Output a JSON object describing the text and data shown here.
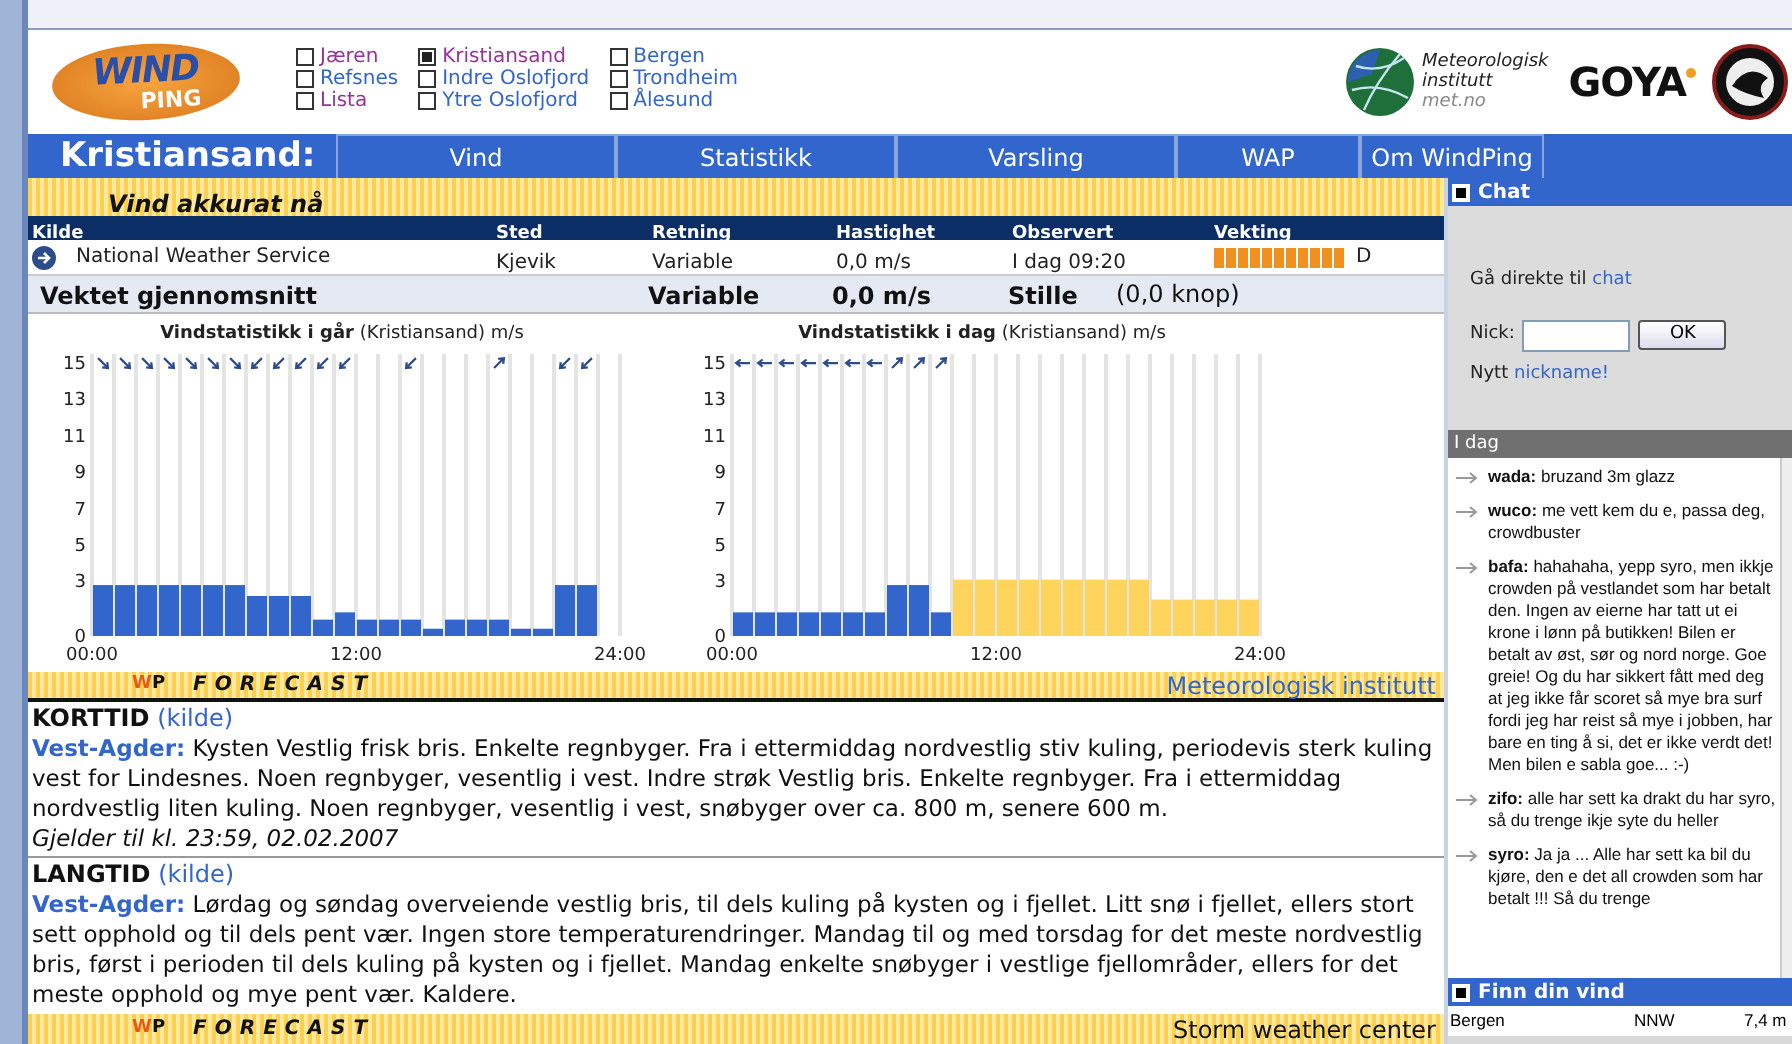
{
  "logo": {
    "word_1": "WIND",
    "word_2": "PING"
  },
  "locations": [
    {
      "label": "Jæren",
      "checked": false,
      "color": "#993399"
    },
    {
      "label": "Refsnes",
      "checked": false,
      "color": "#3366cc"
    },
    {
      "label": "Lista",
      "checked": false,
      "color": "#993399"
    },
    {
      "label": "Kristiansand",
      "checked": true,
      "color": "#993399"
    },
    {
      "label": "Indre Oslofjord",
      "checked": false,
      "color": "#3366cc"
    },
    {
      "label": "Ytre Oslofjord",
      "checked": false,
      "color": "#3366cc"
    },
    {
      "label": "Bergen",
      "checked": false,
      "color": "#3366cc"
    },
    {
      "label": "Trondheim",
      "checked": false,
      "color": "#3366cc"
    },
    {
      "label": "Ålesund",
      "checked": false,
      "color": "#3366cc"
    }
  ],
  "partners": {
    "met_lines": [
      "Meteorologisk",
      "institutt",
      "met.no"
    ],
    "goya": "GOYA"
  },
  "nav": {
    "title": "Kristiansand:",
    "tabs": [
      "Vind",
      "Statistikk",
      "Varsling",
      "WAP",
      "Om WindPing"
    ]
  },
  "current": {
    "title": "Vind akkurat nå",
    "columns": [
      "Kilde",
      "Sted",
      "Retning",
      "Hastighet",
      "Observert",
      "Vekting"
    ],
    "rows": [
      {
        "cells": [
          "National Weather Service",
          "Kjevik",
          "Variable",
          "0,0 m/s",
          "I dag 09:20"
        ],
        "weight": {
          "level": 1,
          "grade": "D"
        }
      }
    ],
    "average": {
      "label": "Vektet gjennomsnitt",
      "direction": "Variable",
      "speed": "0,0 m/s",
      "description": "Stille",
      "knots": "(0,0 knop)"
    }
  },
  "charts": [
    {
      "arrows": [
        {
          "kind": "se"
        },
        {
          "kind": "se"
        },
        {
          "kind": "se"
        },
        {
          "kind": "se"
        },
        {
          "kind": "se"
        },
        {
          "kind": "se"
        },
        {
          "kind": "se"
        },
        {
          "kind": "sw"
        },
        {
          "kind": "sw"
        },
        {
          "kind": "sw"
        },
        {
          "kind": "sw"
        },
        {
          "kind": "sw"
        },
        {
          "kind": "none"
        },
        {
          "kind": "none"
        },
        {
          "kind": "sw"
        },
        {
          "kind": "none"
        },
        {
          "kind": "none"
        },
        {
          "kind": "none"
        },
        {
          "kind": "ne"
        },
        {
          "kind": "none"
        },
        {
          "kind": "none"
        },
        {
          "kind": "sw"
        },
        {
          "kind": "sw"
        },
        {
          "kind": "none"
        }
      ],
      "chart_data": {
        "type": "bar",
        "title": "**Vindstatistikk i går** (Kristiansand) m/s",
        "x": [
          0.5,
          1.5,
          2.5,
          3.5,
          4.5,
          5.5,
          6.5,
          7.5,
          8.5,
          9.5,
          10.5,
          11.5,
          12.5,
          13.5,
          14.5,
          15.5,
          16.5,
          17.5,
          18.5,
          19.5,
          20.5,
          21.5,
          22.5
        ],
        "xlim": [
          0,
          24
        ],
        "xticks": [
          {
            "value": 0,
            "label": "00:00"
          },
          {
            "value": 12,
            "label": "12:00"
          },
          {
            "value": 24,
            "label": "24:00"
          }
        ],
        "ylim": [
          0,
          15.5
        ],
        "yticks": [
          0,
          3,
          5,
          7,
          9,
          11,
          13,
          15
        ],
        "series": [
          {
            "color": "#3366cc",
            "values": [
              2.8,
              2.8,
              2.8,
              2.8,
              2.8,
              2.8,
              2.8,
              2.2,
              2.2,
              2.2,
              0.9,
              1.3,
              0.9,
              0.9,
              0.9,
              0.4,
              0.9,
              0.9,
              0.9,
              0.4,
              0.4,
              2.8,
              2.8
            ]
          }
        ]
      }
    },
    {
      "arrows": [
        {
          "kind": "w"
        },
        {
          "kind": "w"
        },
        {
          "kind": "w"
        },
        {
          "kind": "w"
        },
        {
          "kind": "w"
        },
        {
          "kind": "w"
        },
        {
          "kind": "w"
        },
        {
          "kind": "ne"
        },
        {
          "kind": "ne"
        },
        {
          "kind": "ne"
        },
        {
          "kind": "none"
        },
        {
          "kind": "none"
        },
        {
          "kind": "none"
        },
        {
          "kind": "none"
        },
        {
          "kind": "none"
        },
        {
          "kind": "none"
        },
        {
          "kind": "none"
        },
        {
          "kind": "none"
        },
        {
          "kind": "none"
        },
        {
          "kind": "none"
        },
        {
          "kind": "none"
        },
        {
          "kind": "none"
        },
        {
          "kind": "none"
        },
        {
          "kind": "none"
        }
      ],
      "chart_data": {
        "type": "bar",
        "title": "**Vindstatistikk i dag** (Kristiansand) m/s",
        "x": [
          0.5,
          1.5,
          2.5,
          3.5,
          4.5,
          5.5,
          6.5,
          7.5,
          8.5,
          9.5,
          10.5,
          11.5,
          12.5,
          13.5,
          14.5,
          15.5,
          16.5,
          17.5,
          18.5,
          19.5,
          20.5,
          21.5,
          22.5,
          23.5
        ],
        "xlim": [
          0,
          24
        ],
        "xticks": [
          {
            "value": 0,
            "label": "00:00"
          },
          {
            "value": 12,
            "label": "12:00"
          },
          {
            "value": 24,
            "label": "24:00"
          }
        ],
        "ylim": [
          0,
          15.5
        ],
        "yticks": [
          0,
          3,
          5,
          7,
          9,
          11,
          13,
          15
        ],
        "series": [
          {
            "color": "#3366cc",
            "values": [
              1.3,
              1.3,
              1.3,
              1.3,
              1.3,
              1.3,
              1.3,
              2.8,
              2.8,
              1.3,
              null,
              null,
              null,
              null,
              null,
              null,
              null,
              null,
              null,
              null,
              null,
              null,
              null,
              null
            ]
          },
          {
            "color": "#ffd45c",
            "values": [
              null,
              null,
              null,
              null,
              null,
              null,
              null,
              null,
              null,
              null,
              3.1,
              3.1,
              3.1,
              3.1,
              3.1,
              3.1,
              3.1,
              3.1,
              3.1,
              2.0,
              2.0,
              2.0,
              2.0,
              2.0
            ]
          }
        ]
      }
    }
  ],
  "forecast_bars": [
    {
      "mark_1": "W",
      "mark_2": "P",
      "label": "FORECAST",
      "credit": "Meteorologisk institutt"
    },
    {
      "mark_1": "W",
      "mark_2": "P",
      "label": "FORECAST",
      "credit": "Storm weather center"
    }
  ],
  "forecasts": [
    {
      "title": "KORTTID",
      "link": "(kilde)",
      "region": "Vest-Agder:",
      "text": "Kysten Vestlig frisk bris. Enkelte regnbyger. Fra i ettermiddag nordvestlig stiv kuling, periodevis sterk kuling vest for Lindesnes. Noen regnbyger, vesentlig i vest. Indre strøk Vestlig bris. Enkelte regnbyger. Fra i ettermiddag nordvestlig liten kuling. Noen regnbyger, vesentlig i vest, snøbyger over ca. 800 m, senere 600 m.",
      "valid": "Gjelder til kl. 23:59, 02.02.2007"
    },
    {
      "title": "LANGTID",
      "link": "(kilde)",
      "region": "Vest-Agder:",
      "text": "Lørdag og søndag overveiende vestlig bris, til dels kuling på kysten og i fjellet. Litt snø i fjellet, ellers stort sett opphold og til dels pent vær. Ingen store temperaturendringer. Mandag til og med torsdag for det meste nordvestlig bris, først i perioden til dels kuling på kysten og i fjellet. Mandag enkelte snøbyger i vestlige fjellområder, ellers for det meste opphold og mye pent vær. Kaldere."
    }
  ],
  "chat": {
    "title": "Chat",
    "intro": "Gå direkte til",
    "intro_link": "chat",
    "nick_label": "Nick:",
    "ok": "OK",
    "new_text": "Nytt",
    "new_link": "nickname!",
    "day": "I dag",
    "messages": [
      {
        "user": "wada:",
        "text": "bruzand 3m glazz"
      },
      {
        "user": "wuco:",
        "text": "me vett kem du e, passa deg, crowdbuster"
      },
      {
        "user": "bafa:",
        "text": "hahahaha, yepp syro, men ikkje crowden på vestlandet som har betalt den. Ingen av eierne har tatt ut ei krone i lønn på butikken! Bilen er betalt av øst, sør og nord norge. Goe greie! Og du har sikkert fått med deg at jeg ikke får scoret så mye bra surf fordi jeg har reist så mye i jobben, har bare en ting å si, det er ikke verdt det! Men bilen e sabla goe... :-)"
      },
      {
        "user": "zifo:",
        "text": "alle har sett ka drakt du har syro, så du trenge ikje syte du heller"
      },
      {
        "user": "syro:",
        "text": "Ja ja ... Alle har sett ka bil du kjøre, den e det all crowden som har betalt !!! Så du trenge"
      }
    ]
  },
  "find_wind": {
    "title": "Finn din vind",
    "rows": [
      {
        "place": "Bergen",
        "direction": "NNW",
        "speed": "7,4 m"
      }
    ]
  }
}
